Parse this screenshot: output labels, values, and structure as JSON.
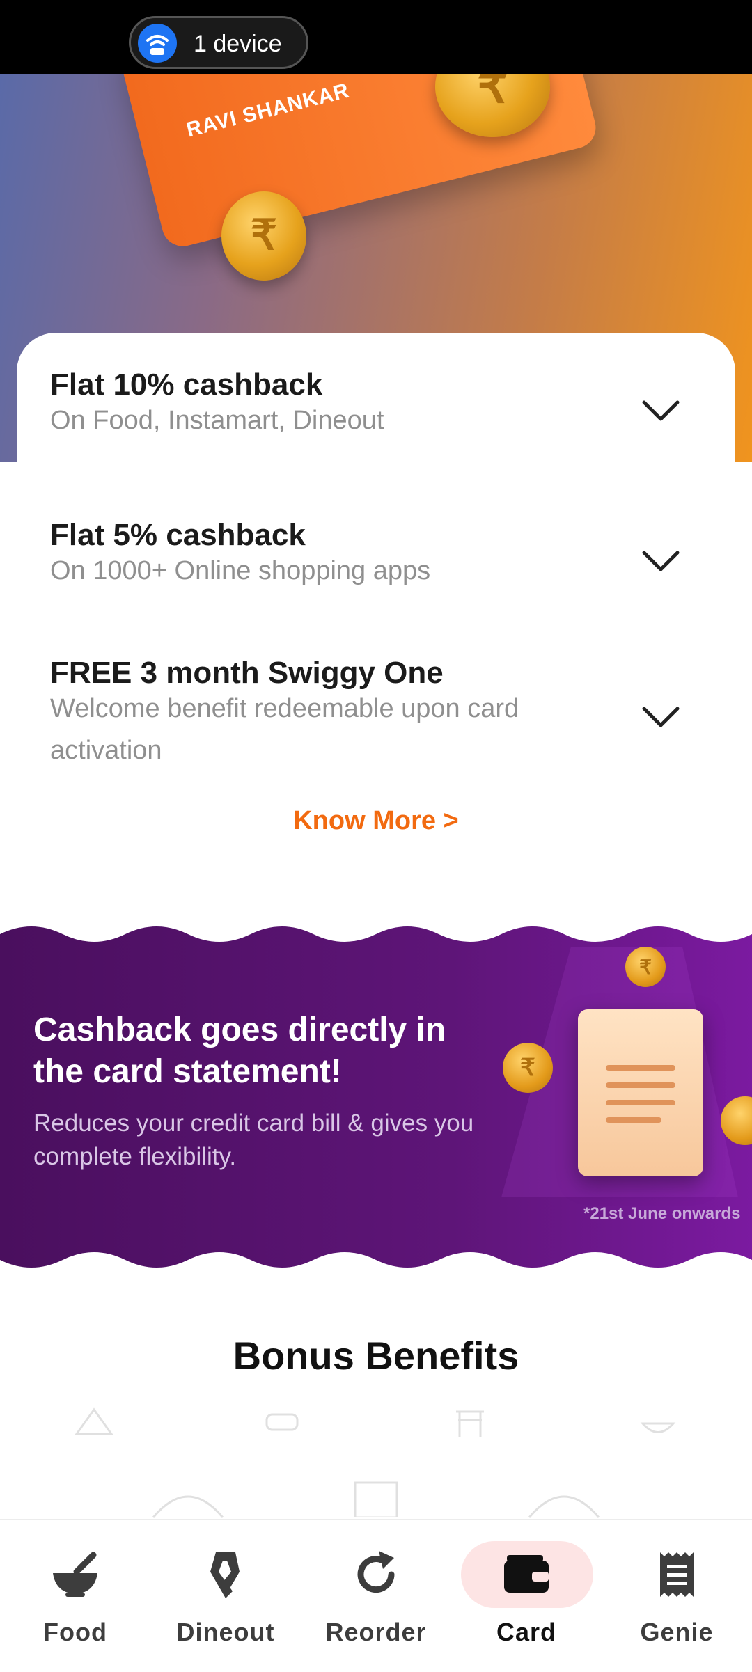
{
  "status_bar": {
    "device_label": "1 device"
  },
  "hero": {
    "card_name": "RAVI SHANKAR",
    "coin_symbol": "₹"
  },
  "benefits": [
    {
      "title": "Flat 10% cashback",
      "subtitle": "On Food, Instamart, Dineout"
    },
    {
      "title": "Flat 5% cashback",
      "subtitle": "On 1000+ Online shopping apps"
    },
    {
      "title": "FREE 3 month Swiggy One",
      "subtitle": "Welcome benefit redeemable upon card activation"
    }
  ],
  "know_more": "Know More >",
  "banner": {
    "title": "Cashback goes directly in the card statement!",
    "subtitle": "Reduces your credit card bill & gives you complete flexibility.",
    "note": "*21st June onwards"
  },
  "bonus_title": "Bonus Benefits",
  "nav": [
    {
      "label": "Food",
      "icon": "bowl-icon"
    },
    {
      "label": "Dineout",
      "icon": "ribbon-icon"
    },
    {
      "label": "Reorder",
      "icon": "refresh-icon"
    },
    {
      "label": "Card",
      "icon": "wallet-icon",
      "active": true
    },
    {
      "label": "Genie",
      "icon": "receipt-icon"
    }
  ],
  "colors": {
    "accent": "#f26a10",
    "banner_purple": "#5a1470",
    "active_pill": "#fde4e4"
  }
}
